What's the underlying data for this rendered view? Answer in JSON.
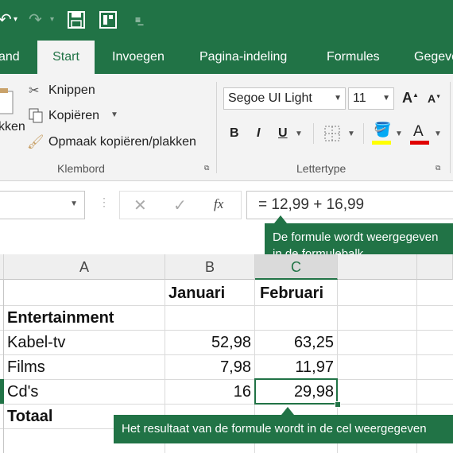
{
  "ribbon": {
    "tabs": [
      "and",
      "Start",
      "Invoegen",
      "Pagina-indeling",
      "Formules",
      "Gegeve"
    ],
    "clipboard": {
      "paste_partial": "kken",
      "cut": "Knippen",
      "copy": "Kopiëren",
      "format_painter": "Opmaak kopiëren/plakken",
      "group_label": "Klembord"
    },
    "font": {
      "name": "Segoe UI Light",
      "size": "11",
      "bold": "B",
      "italic": "I",
      "underline": "U",
      "grow": "A",
      "shrink": "A",
      "font_color_letter": "A",
      "group_label": "Lettertype"
    }
  },
  "formula_bar": {
    "fx": "fx",
    "formula": "= 12,99 + 16,99",
    "callout_line1": "De formule wordt weergegeven",
    "callout_line2": "in de formulebalk."
  },
  "sheet": {
    "columns": [
      "A",
      "B",
      "C"
    ],
    "rows": [
      {
        "a": "",
        "b": "Januari",
        "c": "Februari"
      },
      {
        "a": "Entertainment",
        "b": "",
        "c": ""
      },
      {
        "a": "Kabel-tv",
        "b": "52,98",
        "c": "63,25"
      },
      {
        "a": "Films",
        "b": "7,98",
        "c": "11,97"
      },
      {
        "a": "Cd's",
        "b": "16",
        "c": "29,98"
      },
      {
        "a": "Totaal",
        "b": "",
        "c": ""
      }
    ],
    "result_callout": "Het resultaat van de formule wordt in de cel weergegeven"
  },
  "colors": {
    "accent": "#217346",
    "font_color_bar": "#e00000",
    "highlight_bar": "#ffff00"
  }
}
